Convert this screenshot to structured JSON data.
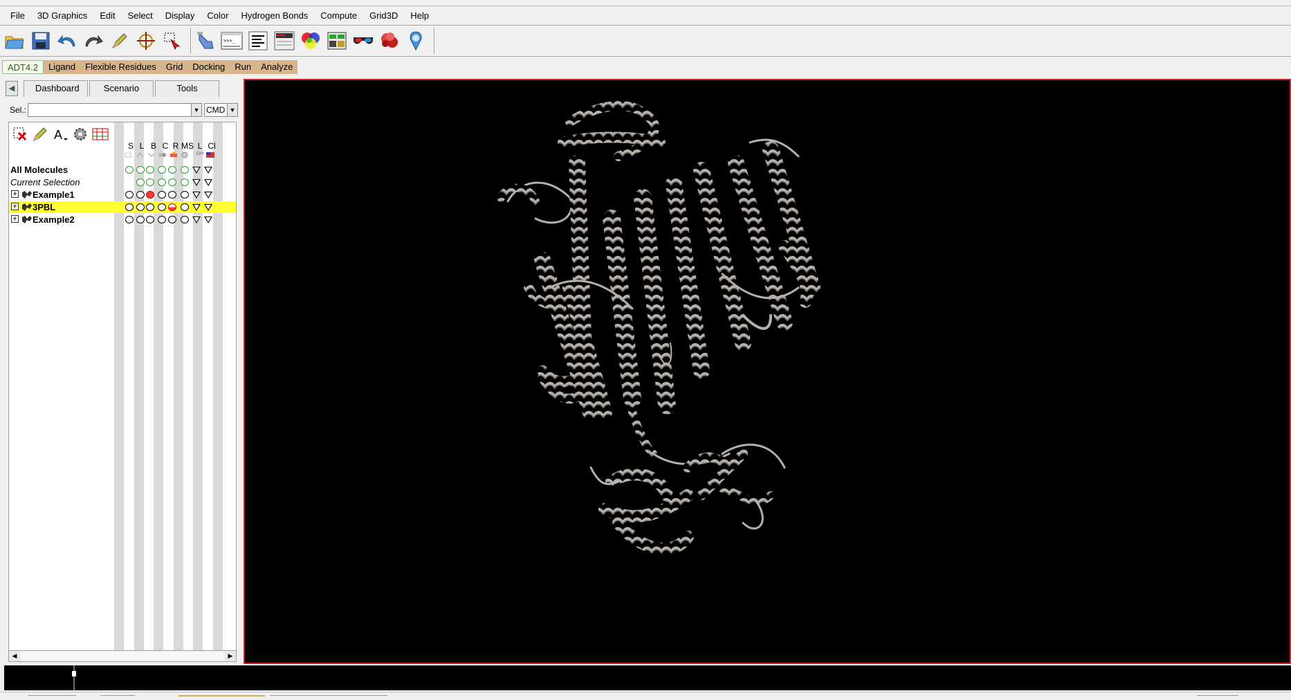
{
  "menu": [
    "File",
    "3D Graphics",
    "Edit",
    "Select",
    "Display",
    "Color",
    "Hydrogen Bonds",
    "Compute",
    "Grid3D",
    "Help"
  ],
  "toolbar_icons": [
    "open-file-icon",
    "save-icon",
    "undo-icon",
    "redo-icon",
    "pencil-icon",
    "crosshair-icon",
    "selection-icon",
    "pick-hand-icon",
    "python-shell-icon",
    "text-align-icon",
    "dashboard-icon",
    "color-spheres-icon",
    "grid-panels-icon",
    "stereo-glasses-icon",
    "molecule-surface-icon",
    "pmv-logo-icon"
  ],
  "adt": {
    "version": "ADT4.2",
    "tabs": [
      "Ligand",
      "Flexible Residues",
      "Grid",
      "Docking",
      "Run",
      "Analyze"
    ]
  },
  "dashboard": {
    "tabs": [
      "Dashboard",
      "Scenario",
      "Tools"
    ],
    "sel_label": "Sel.:",
    "sel_value": "",
    "cmd_value": "CMD",
    "columns": [
      {
        "head": "S",
        "sub": ""
      },
      {
        "head": "L",
        "sub": ""
      },
      {
        "head": "B",
        "sub": ""
      },
      {
        "head": "C",
        "sub": ""
      },
      {
        "head": "R",
        "sub": ""
      },
      {
        "head": "MS",
        "sub": ""
      },
      {
        "head": "L",
        "sub": "OH"
      },
      {
        "head": "Cl",
        "sub": ""
      }
    ],
    "rows": [
      {
        "label": "All Molecules",
        "style": "bold"
      },
      {
        "label": "Current Selection",
        "style": "italic"
      },
      {
        "label": "Example1",
        "style": "bold"
      },
      {
        "label": "3PBL",
        "style": "bold"
      },
      {
        "label": "Example2",
        "style": "bold"
      }
    ]
  },
  "colors": {
    "viewer_border": "#cc2222",
    "selection_highlight": "#ffff33",
    "adt_tab": "#d8b48c",
    "ribbon": "#b6b0aa"
  }
}
